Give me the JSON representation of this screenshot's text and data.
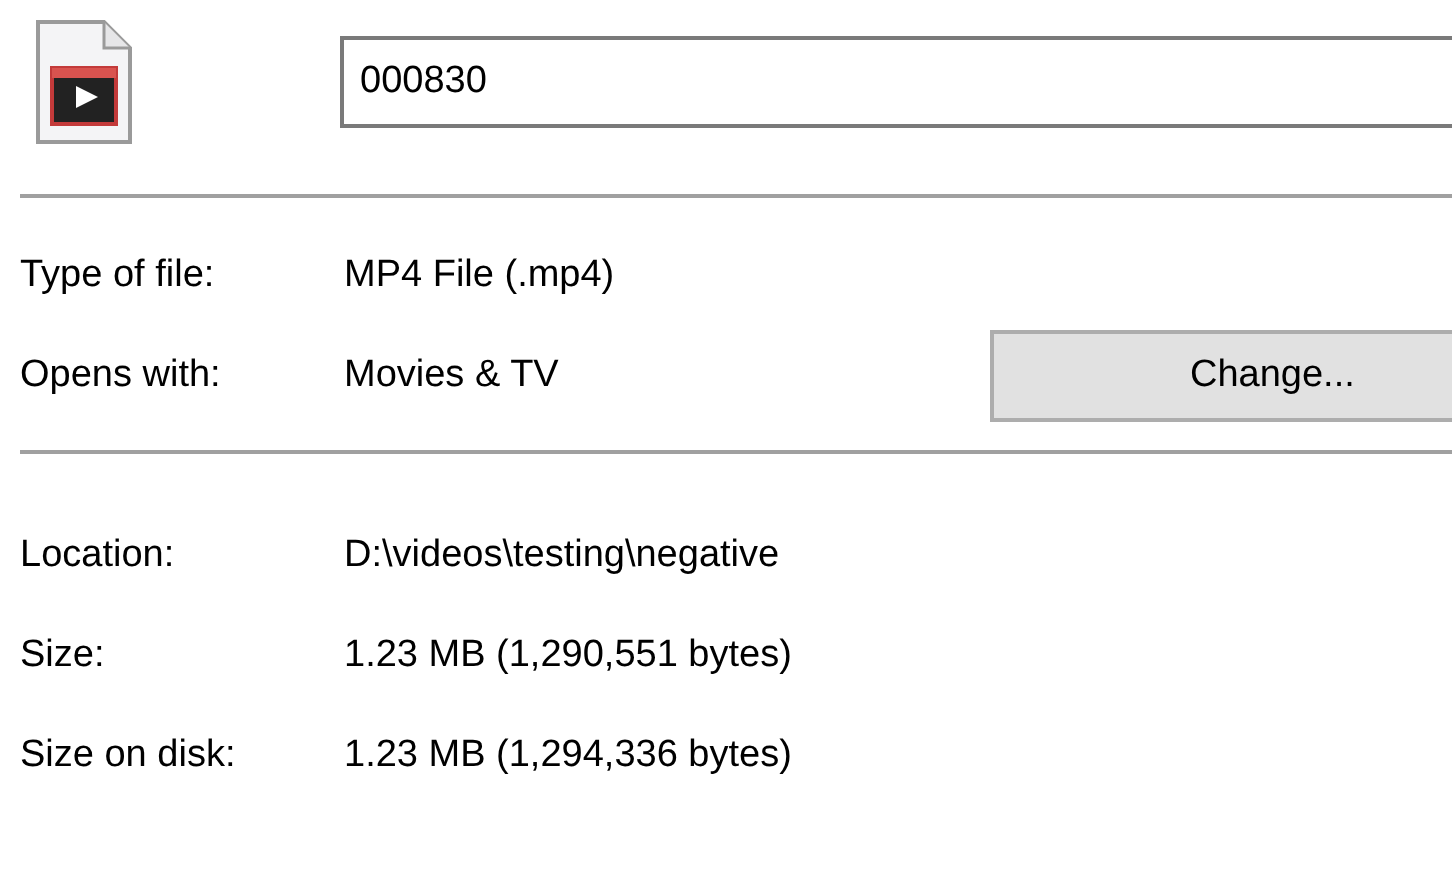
{
  "file_name": {
    "value": "000830"
  },
  "type_rows": [
    {
      "label": "Type of file:",
      "value": "MP4 File (.mp4)"
    },
    {
      "label": "Opens with:",
      "value": "Movies & TV",
      "button": "Change..."
    }
  ],
  "details": [
    {
      "label": "Location:",
      "value": "D:\\videos\\testing\\negative"
    },
    {
      "label": "Size:",
      "value": "1.23 MB (1,290,551 bytes)"
    },
    {
      "label": "Size on disk:",
      "value": "1.23 MB (1,294,336 bytes)"
    }
  ]
}
